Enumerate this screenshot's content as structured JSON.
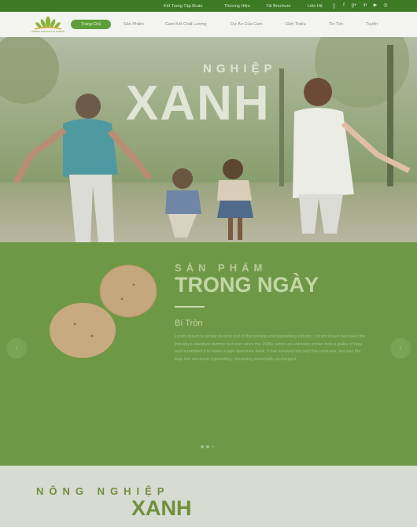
{
  "topbar": {
    "links": [
      "Kết Trang Tập Đoàn",
      "Thương Hiệu",
      "Tải Brochure",
      "Liên Hệ"
    ],
    "social_icons": [
      "facebook-icon",
      "google-plus-icon",
      "linkedin-icon",
      "youtube-icon",
      "instagram-icon"
    ]
  },
  "nav": {
    "logo_text": "HOÀNG ANH GIA LAI GROUP",
    "items": [
      "Trang Chủ",
      "Sản Phẩm",
      "Cam Kết Chất Lượng",
      "Dự Án Của Cam",
      "Giới Thiệu",
      "Tin Tức",
      "Tuyển"
    ]
  },
  "hero": {
    "subtitle": "NGHIỆP",
    "title": "XANH"
  },
  "product": {
    "label": "SẢN PHẨM",
    "title": "TRONG NGÀY",
    "name": "Bí Tròn",
    "description": "Lorem Ipsum is simply dummy text of the printing and typesetting industry. Lorem Ipsum has been the industry's standard dummy text ever since the 1500s, when an unknown printer took a galley of type and scrambled it to make a type specimen book. It has survived not only five centuries, but also the leap into electronic typesetting, remaining essentially unchanged.",
    "prev_icon": "chevron-left-icon",
    "next_icon": "chevron-right-icon"
  },
  "bottom": {
    "subtitle": "NÔNG NGHIỆP",
    "title": "XANH"
  },
  "colors": {
    "topbar": "#3d7a24",
    "accent": "#5d9e3a",
    "product_bg": "#6e9846"
  }
}
